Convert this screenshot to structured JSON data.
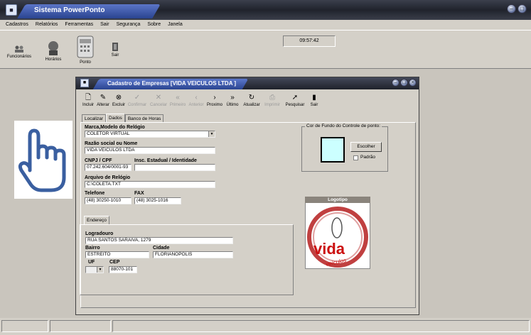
{
  "app": {
    "title": "Sistema PowerPonto",
    "clock": "09:57:42"
  },
  "menu": [
    "Cadastros",
    "Relatórios",
    "Ferramentas",
    "Sair",
    "Segurança",
    "Sobre",
    "Janela"
  ],
  "toolbar": {
    "funcionarios": "Funcionários",
    "horarios": "Horários",
    "ponto": "Ponto",
    "sair": "Sair"
  },
  "child": {
    "title": "Cadastro de Empresas [VIDA VEICULOS LTDA ]",
    "toolbar": {
      "incluir": "Incluir",
      "alterar": "Alterar",
      "excluir": "Excluir",
      "confirmar": "Confirmar",
      "cancelar": "Cancelar",
      "primeiro": "Primeiro",
      "anterior": "Anterior",
      "proximo": "Proximo",
      "ultimo": "Último",
      "atualizar": "Atualizar",
      "imprimir": "Imprimir",
      "pesquisar": "Pesquisar",
      "sair": "Sair"
    },
    "tabs": [
      "Localizar",
      "Dados",
      "Banco de Horas"
    ],
    "form": {
      "marca_label": "Marca,Modelo do Relógio",
      "marca_value": "COLETOR VIRTUAL",
      "razao_label": "Razão social ou Nome",
      "razao_value": "VIDA VEICULOS LTDA",
      "cnpj_label": "CNPJ / CPF",
      "cnpj_value": "07.242.604/0001-93",
      "inscricao_label": "Insc. Estadual / Identidade",
      "inscricao_value": "",
      "arquivo_label": "Arquivo de Relógio",
      "arquivo_value": "C:\\COLETA.TXT",
      "telefone_label": "Telefone",
      "telefone_value": "(48) 30250-1010",
      "fax_label": "FAX",
      "fax_value": "(48) 3025-1016"
    },
    "cor_fundo": {
      "title": "Cor de Fundo do Controle de ponto:",
      "escolher": "Escolher",
      "padrao": "Padrão",
      "color": "#ccffff"
    },
    "logotipo": {
      "title": "Logotipo",
      "brand": "vida",
      "sub": "veículos"
    },
    "endereco": {
      "tab": "Endereço",
      "logradouro_label": "Logradouro",
      "logradouro_value": "RUA SANTOS SARAIVA, 1279",
      "bairro_label": "Bairro",
      "bairro_value": "ESTREITO",
      "cidade_label": "Cidade",
      "cidade_value": "FLORIANOPOLIS",
      "uf_label": "UF",
      "uf_value": "",
      "cep_label": "CEP",
      "cep_value": "88070-101"
    }
  }
}
